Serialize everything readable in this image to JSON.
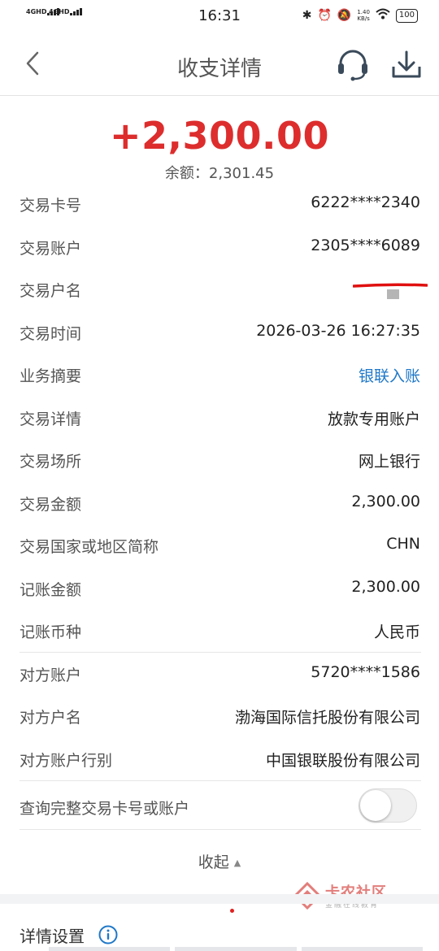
{
  "status_bar": {
    "signal_1": "4GHD",
    "signal_2": "4GHD",
    "time": "16:31",
    "net_speed_value": "1.40",
    "net_speed_unit": "KB/s",
    "battery": "100"
  },
  "nav": {
    "title": "收支详情",
    "icons": [
      "back-arrow-icon",
      "headset-icon",
      "download-icon"
    ]
  },
  "summary": {
    "amount": "+2,300.00",
    "balance": "余额：2,301.45"
  },
  "details": [
    {
      "label": "交易卡号",
      "value": "6222****2340"
    },
    {
      "label": "交易账户",
      "value": "2305****6089"
    },
    {
      "label": "交易户名",
      "value": ""
    },
    {
      "label": "交易时间",
      "value": "2026-03-26 16:27:35"
    },
    {
      "label": "业务摘要",
      "value": "银联入账"
    },
    {
      "label": "交易详情",
      "value": "放款专用账户"
    },
    {
      "label": "交易场所",
      "value": "网上银行"
    },
    {
      "label": "交易金额",
      "value": "2,300.00"
    },
    {
      "label": "交易国家或地区简称",
      "value": "CHN"
    },
    {
      "label": "记账金额",
      "value": "2,300.00"
    },
    {
      "label": "记账币种",
      "value": "人民币"
    },
    {
      "label": "对方账户",
      "value": "5720****1586"
    },
    {
      "label": "对方户名",
      "value": "渤海国际信托股份有限公司"
    },
    {
      "label": "对方账户行别",
      "value": "中国银联股份有限公司"
    }
  ],
  "toggle": {
    "label": "查询完整交易卡号或账户",
    "on": false
  },
  "collapse_label": "收起",
  "settings_title": "详情设置",
  "watermark": {
    "title": "卡农社区",
    "subtitle": "金融在线教育"
  },
  "colors": {
    "amount": "#dd2d2d",
    "link": "#1f78c8",
    "info_icon": "#1f78c8"
  }
}
